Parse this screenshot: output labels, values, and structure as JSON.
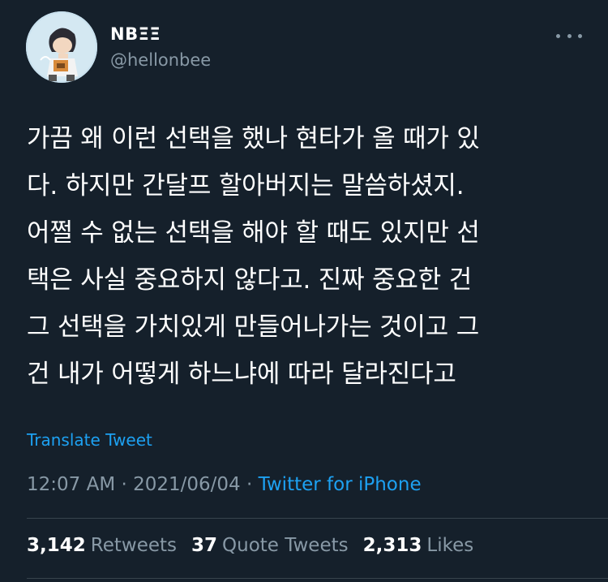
{
  "author": {
    "display_name": "NBΞΞ",
    "handle": "@hellonbee"
  },
  "tweet": {
    "lines": [
      "가끔 왜 이런 선택을 했나 현타가 올 때가 있",
      "다. 하지만 간달프 할아버지는 말씀하셨지.",
      "어쩔 수 없는 선택을 해야 할 때도 있지만 선",
      "택은 사실 중요하지 않다고. 진짜 중요한 건",
      "그 선택을 가치있게 만들어나가는 것이고 그",
      "건 내가 어떻게 하느냐에 따라 달라진다고"
    ],
    "translate_label": "Translate Tweet"
  },
  "meta": {
    "time": "12:07 AM",
    "separator": " · ",
    "date": "2021/06/04",
    "source": "Twitter for iPhone"
  },
  "stats": {
    "retweets_count": "3,142",
    "retweets_label": "Retweets",
    "quotes_count": "37",
    "quotes_label": "Quote Tweets",
    "likes_count": "2,313",
    "likes_label": "Likes"
  },
  "icons": {
    "more": "more-horizontal-icon"
  },
  "colors": {
    "background": "#15202b",
    "accent": "#1da1f2",
    "secondary_text": "#8899a6",
    "divider": "#38444d"
  }
}
